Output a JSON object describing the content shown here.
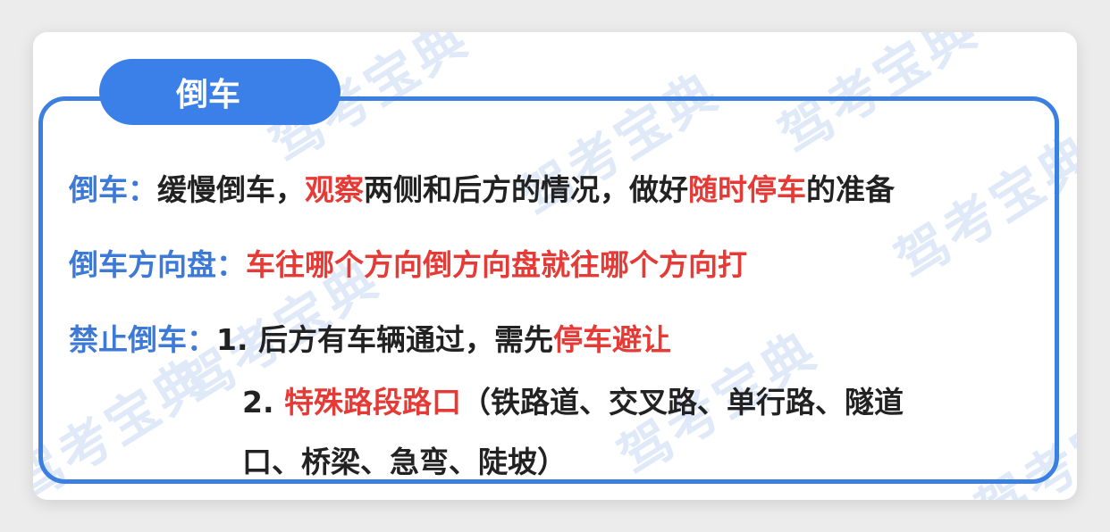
{
  "watermark": "驾考宝典",
  "tab": {
    "title": "倒车"
  },
  "rows": {
    "row1": {
      "label": "倒车：",
      "text_a": "缓慢倒车，",
      "red_a": "观察",
      "text_b": "两侧和后方的情况，做好",
      "red_b": "随时停车",
      "text_c": "的准备"
    },
    "row2": {
      "label": "倒车方向盘：",
      "red": "车往哪个方向倒方向盘就往哪个方向打"
    },
    "row3": {
      "label": "禁止倒车：",
      "num": "1.",
      "text": "后方有车辆通过，需先",
      "red": "停车避让"
    },
    "row4": {
      "num": "2.",
      "red": "特殊路段路口",
      "text": "（铁路道、交叉路、单行路、隧道"
    },
    "row5": {
      "text": "口、桥梁、急弯、陡坡）"
    }
  },
  "colors": {
    "accent_blue": "#3b80e8",
    "label_blue": "#3d79d6",
    "highlight_red": "#e53a35",
    "text_dark": "#222222"
  }
}
